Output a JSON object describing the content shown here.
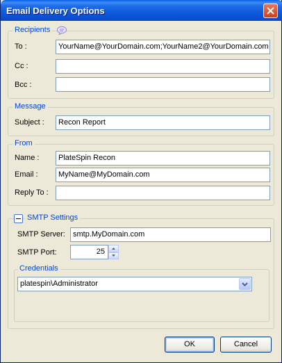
{
  "window": {
    "title": "Email Delivery Options"
  },
  "recipients": {
    "legend": "Recipients",
    "to_label": "To :",
    "to_value": "YourName@YourDomain.com;YourName2@YourDomain.com",
    "cc_label": "Cc :",
    "cc_value": "",
    "bcc_label": "Bcc :",
    "bcc_value": ""
  },
  "message": {
    "legend": "Message",
    "subject_label": "Subject :",
    "subject_value": "Recon Report"
  },
  "from": {
    "legend": "From",
    "name_label": "Name :",
    "name_value": "PlateSpin Recon",
    "email_label": "Email :",
    "email_value": "MyName@MyDomain.com",
    "reply_label": "Reply To :",
    "reply_value": ""
  },
  "smtp": {
    "legend": "SMTP Settings",
    "server_label": "SMTP Server:",
    "server_value": "smtp.MyDomain.com",
    "port_label": "SMTP Port:",
    "port_value": "25"
  },
  "credentials": {
    "legend": "Credentials",
    "selected": "platespin\\Administrator"
  },
  "buttons": {
    "ok": "OK",
    "cancel": "Cancel"
  },
  "icons": {
    "recipients_hint": "speech-bubble-icon",
    "close": "close-icon",
    "collapse": "collapse-minus-icon",
    "dropdown": "chevron-down-icon"
  }
}
